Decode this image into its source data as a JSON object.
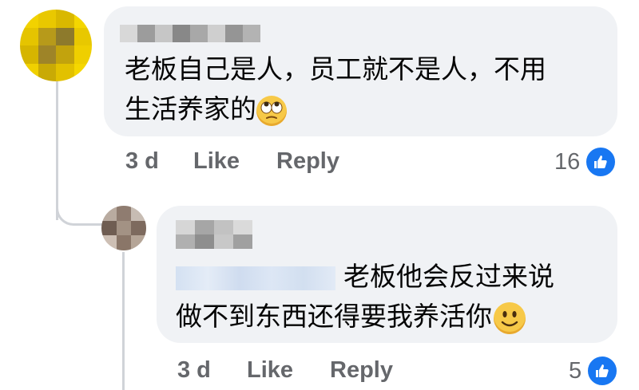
{
  "comment": {
    "text_line1": "老板自己是人，员工就不是人，不用",
    "text_line2": "生活养家的",
    "emoji": "eye-roll-emoji",
    "time": "3 d",
    "like_label": "Like",
    "reply_label": "Reply",
    "reaction_count": "16"
  },
  "reply": {
    "text_line1": "老板他会反过来说",
    "text_line2": "做不到东西还得要我养活你",
    "emoji": "smiling-emoji",
    "time": "3 d",
    "like_label": "Like",
    "reply_label": "Reply",
    "reaction_count": "5"
  },
  "colors": {
    "bubble": "#f0f2f5",
    "meta_text": "#65676b",
    "like_blue": "#1877f2"
  }
}
